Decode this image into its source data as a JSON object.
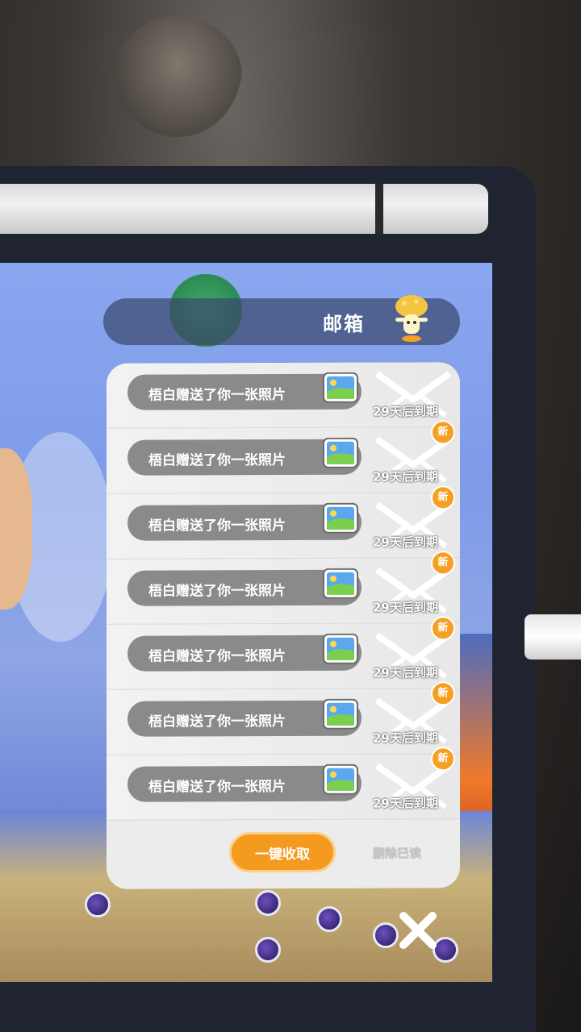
{
  "header": {
    "title": "邮箱",
    "mascot_icon": "mushroom-mascot-icon"
  },
  "mail_items": [
    {
      "subject": "梧白赠送了你一张照片",
      "expiry": "29天后到期",
      "badge": "新",
      "icon": "photo-icon"
    },
    {
      "subject": "梧白赠送了你一张照片",
      "expiry": "29天后到期",
      "badge": "新",
      "icon": "photo-icon"
    },
    {
      "subject": "梧白赠送了你一张照片",
      "expiry": "29天后到期",
      "badge": "新",
      "icon": "photo-icon"
    },
    {
      "subject": "梧白赠送了你一张照片",
      "expiry": "29天后到期",
      "badge": "新",
      "icon": "photo-icon"
    },
    {
      "subject": "梧白赠送了你一张照片",
      "expiry": "29天后到期",
      "badge": "新",
      "icon": "photo-icon"
    },
    {
      "subject": "梧白赠送了你一张照片",
      "expiry": "29天后到期",
      "badge": "新",
      "icon": "photo-icon"
    },
    {
      "subject": "梧白赠送了你一张照片",
      "expiry": "29天后到期",
      "badge": "",
      "icon": "photo-icon"
    }
  ],
  "actions": {
    "collect_all": "一键收取",
    "delete_read": "删除已读"
  },
  "close_icon": "close-icon",
  "colors": {
    "accent": "#f39a1f",
    "panel_bg": "#ececec",
    "pill_bg": "#8a8a8a",
    "header_bg": "#3c486e"
  }
}
